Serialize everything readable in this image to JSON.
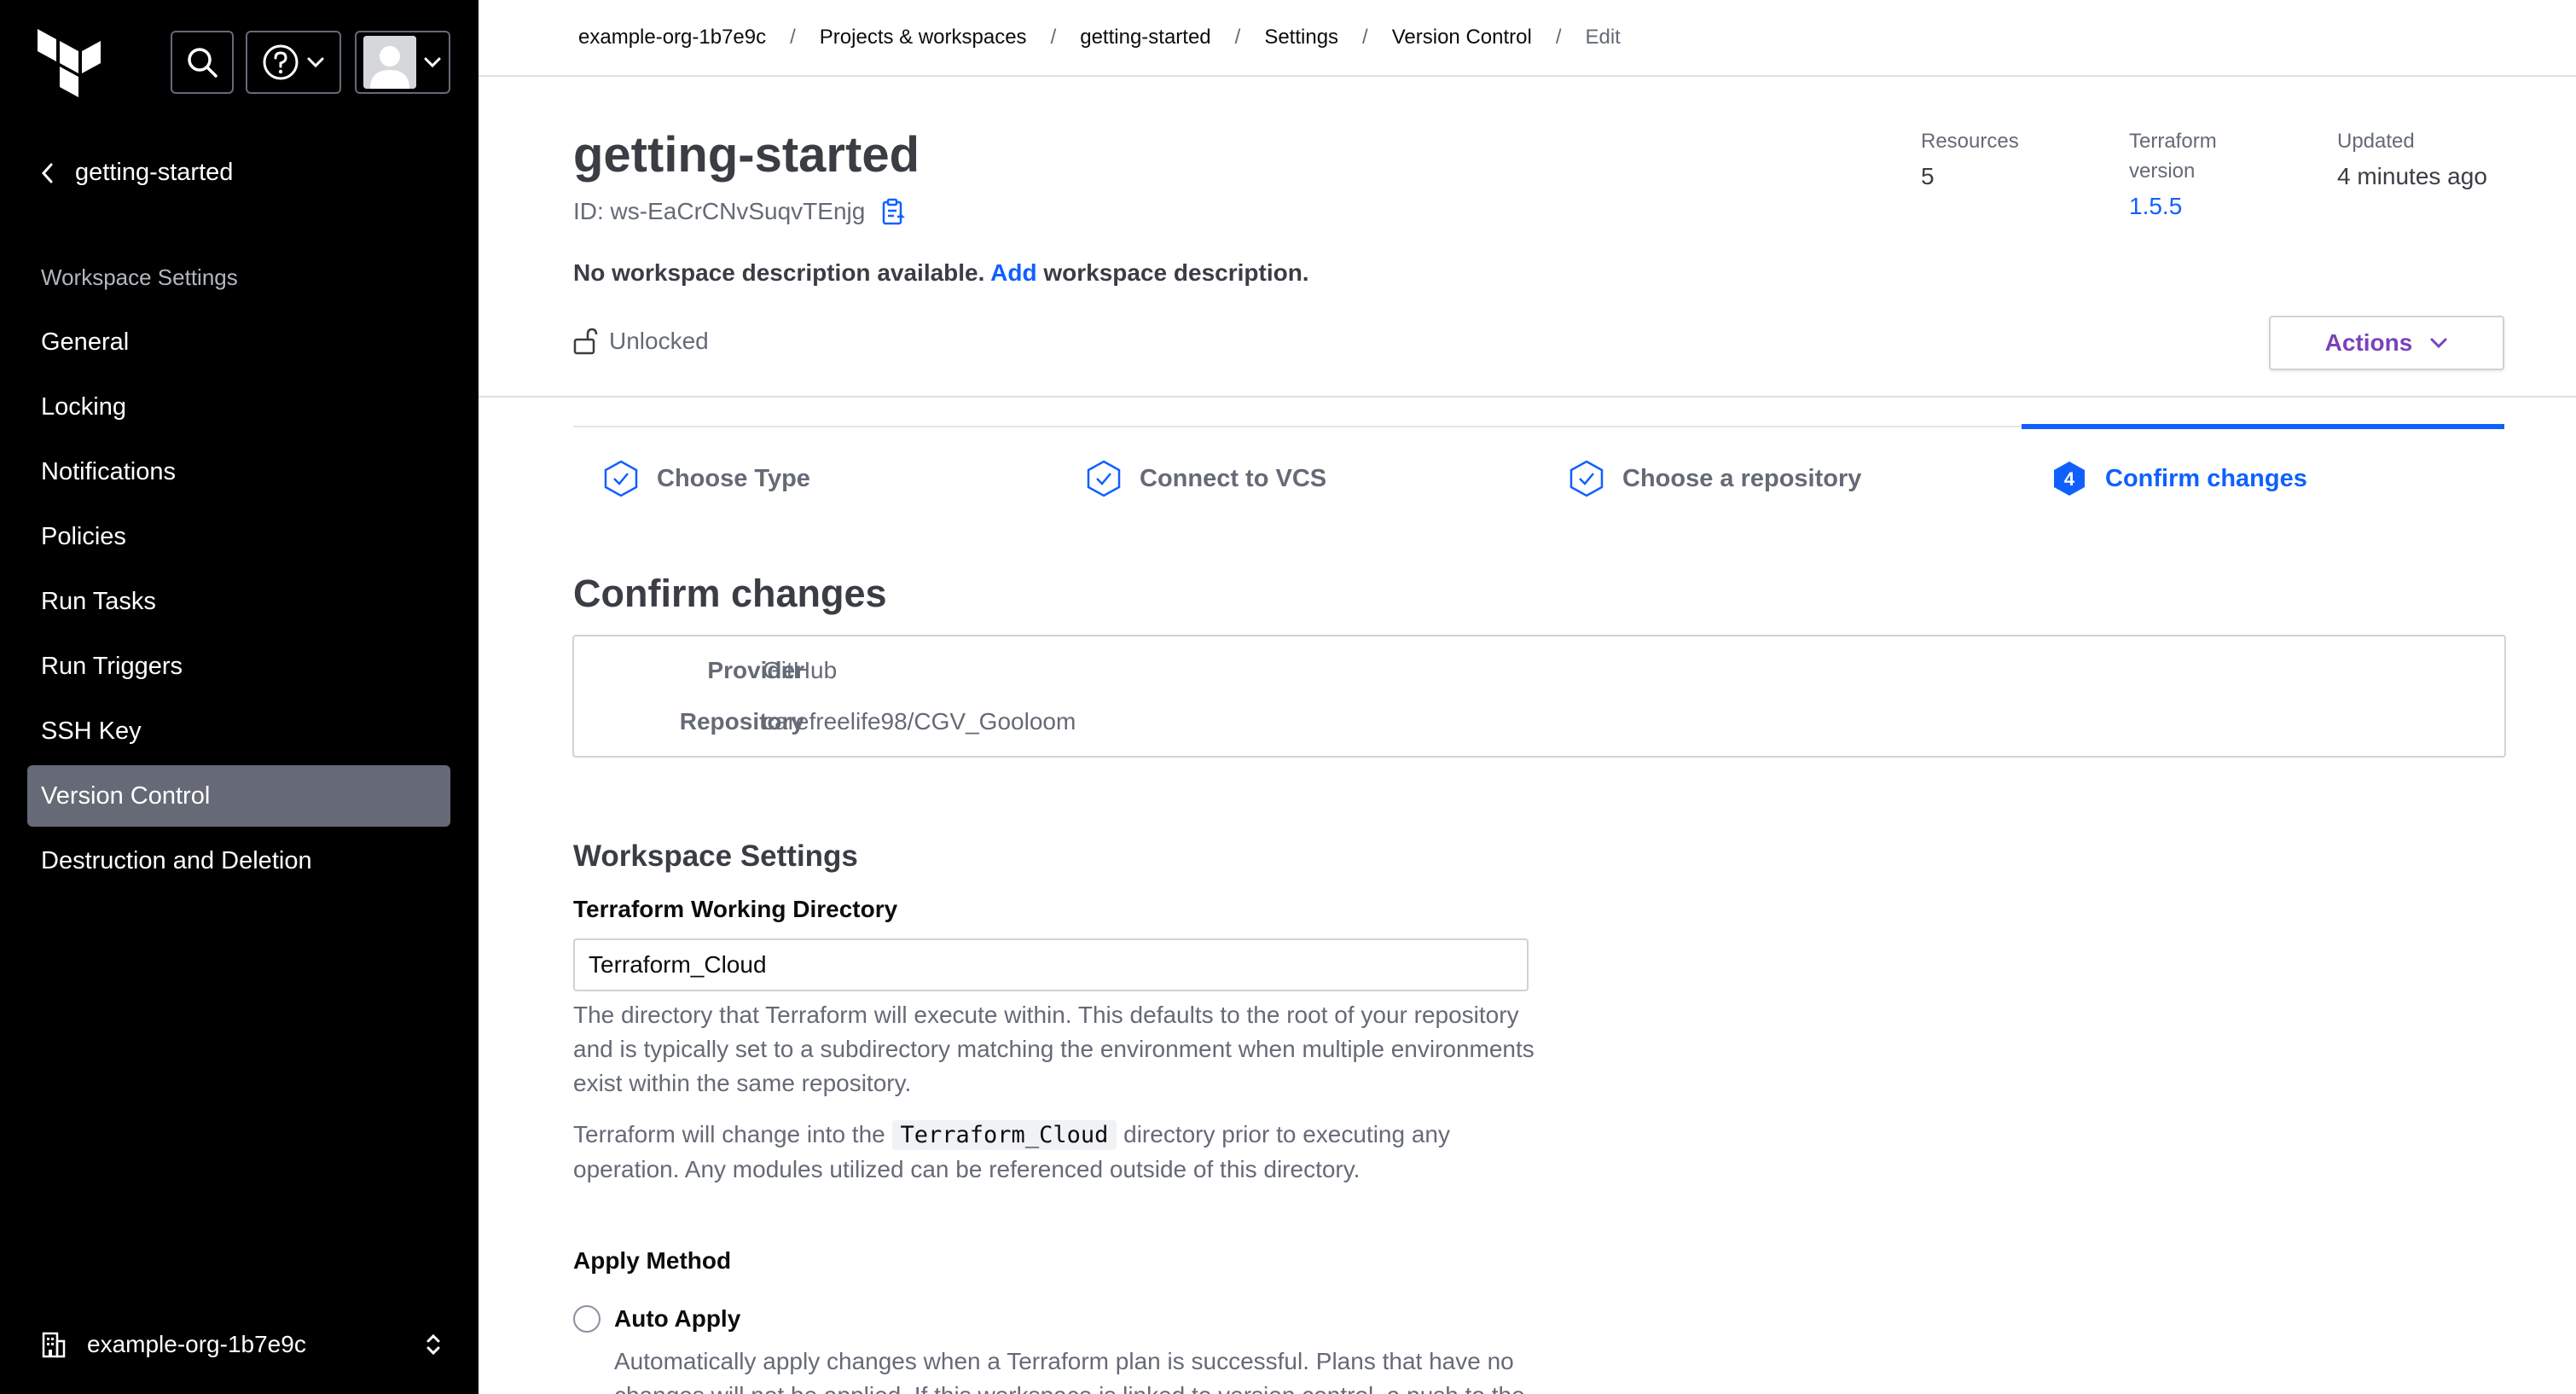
{
  "sidebar": {
    "back_label": "getting-started",
    "section_title": "Workspace Settings",
    "items": [
      {
        "label": "General",
        "active": false
      },
      {
        "label": "Locking",
        "active": false
      },
      {
        "label": "Notifications",
        "active": false
      },
      {
        "label": "Policies",
        "active": false
      },
      {
        "label": "Run Tasks",
        "active": false
      },
      {
        "label": "Run Triggers",
        "active": false
      },
      {
        "label": "SSH Key",
        "active": false
      },
      {
        "label": "Version Control",
        "active": true
      },
      {
        "label": "Destruction and Deletion",
        "active": false
      }
    ],
    "org_name": "example-org-1b7e9c",
    "icons": {
      "logo": "terraform-logo",
      "search": "search-icon",
      "help": "help-icon",
      "user": "user-avatar",
      "back": "chevron-left-icon",
      "org": "building-icon",
      "org_toggle": "chevron-up-down-icon"
    }
  },
  "breadcrumb": {
    "items": [
      "example-org-1b7e9c",
      "Projects & workspaces",
      "getting-started",
      "Settings",
      "Version Control",
      "Edit"
    ],
    "separator": "/"
  },
  "workspace": {
    "name": "getting-started",
    "id_text": "ID: ws-EaCrCNvSuqvTEnjg",
    "desc_before": "No workspace description available.",
    "desc_link": "Add",
    "desc_after": "workspace description.",
    "lock_status": "Unlocked",
    "meta": {
      "resources_label": "Resources",
      "resources_value": "5",
      "tf_version_label_1": "Terraform",
      "tf_version_label_2": "version",
      "tf_version_value": "1.5.5",
      "updated_label": "Updated",
      "updated_value": "4 minutes ago"
    },
    "actions_label": "Actions"
  },
  "steps": [
    {
      "label": "Choose Type",
      "state": "done"
    },
    {
      "label": "Connect to VCS",
      "state": "done"
    },
    {
      "label": "Choose a repository",
      "state": "done"
    },
    {
      "label": "Confirm changes",
      "state": "active",
      "number": "4"
    }
  ],
  "confirm": {
    "title": "Confirm changes",
    "provider_label": "Provider",
    "provider_value": "GitHub",
    "repository_label": "Repository",
    "repository_value": "carefreelife98/CGV_Gooloom"
  },
  "settings": {
    "title": "Workspace Settings",
    "working_dir_label": "Terraform Working Directory",
    "working_dir_value": "Terraform_Cloud",
    "help_1": "The directory that Terraform will execute within. This defaults to the root of your repository and is typically set to a subdirectory matching the environment when multiple environments exist within the same repository.",
    "help_2_before": "Terraform will change into the",
    "help_2_code": "Terraform_Cloud",
    "help_2_after": "directory prior to executing any operation. Any modules utilized can be referenced outside of this directory.",
    "apply_method_label": "Apply Method",
    "auto_apply_label": "Auto Apply",
    "auto_apply_help": "Automatically apply changes when a Terraform plan is successful. Plans that have no changes will not be applied. If this workspace is linked to version control, a push to the"
  },
  "colors": {
    "sidebar_bg": "#000000",
    "active_nav": "#656a76",
    "link": "#1060ff",
    "actions": "#7b42bc"
  }
}
